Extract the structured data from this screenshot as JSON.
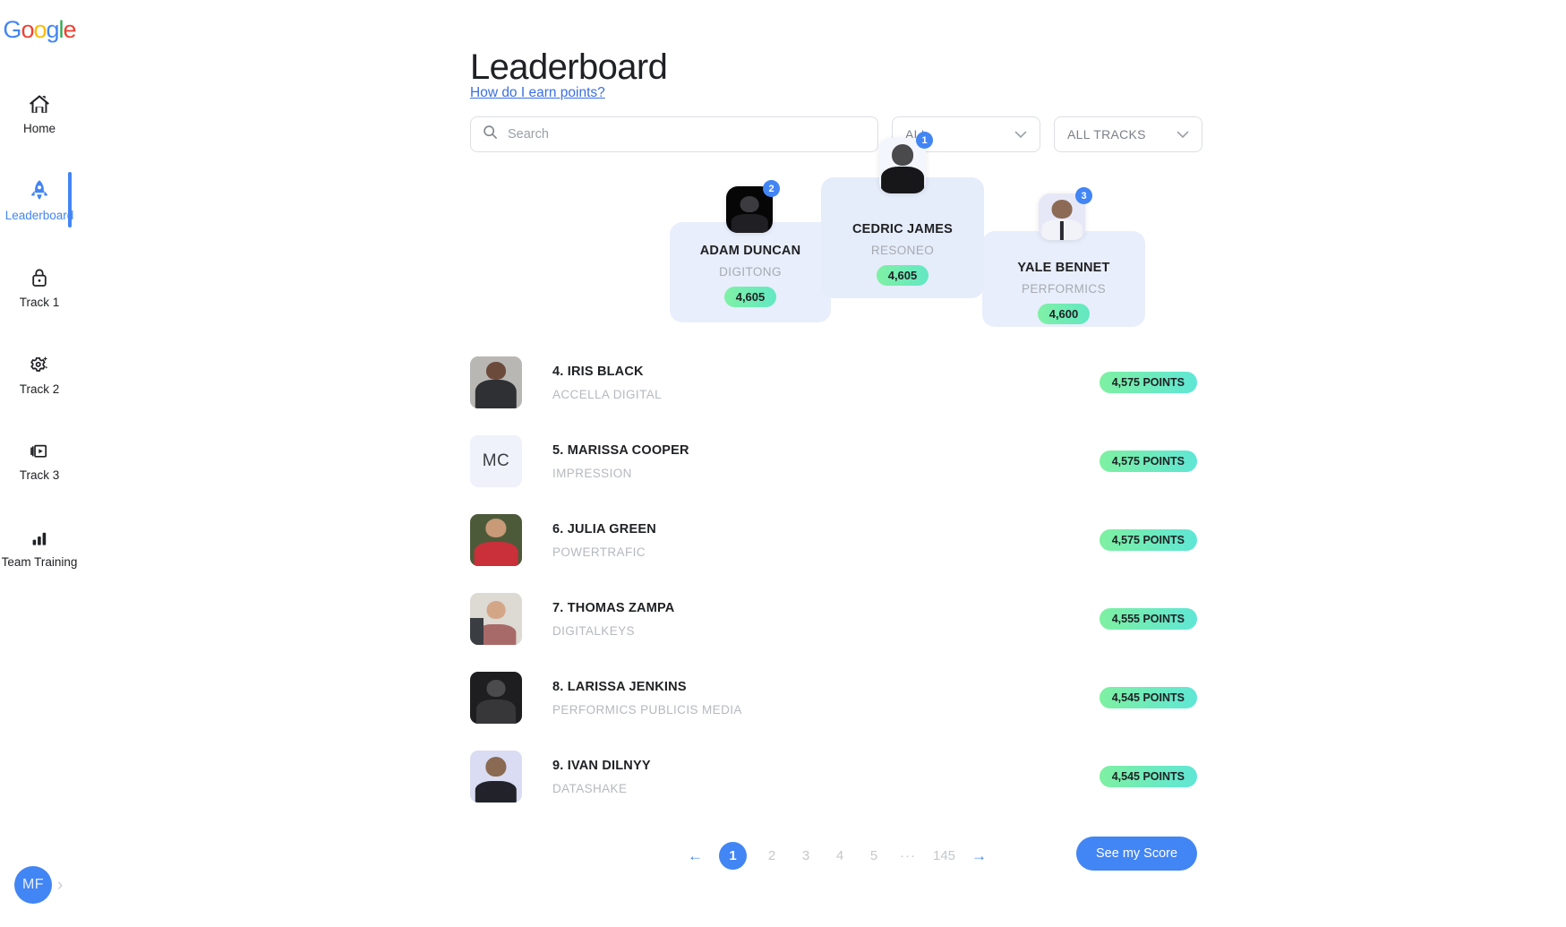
{
  "brand": {
    "logo_letters": [
      "G",
      "o",
      "o",
      "g",
      "l",
      "e"
    ]
  },
  "sidebar": {
    "items": [
      {
        "label": "Home",
        "icon": "home-icon",
        "active": false
      },
      {
        "label": "Leaderboard",
        "icon": "rocket-icon",
        "active": true
      },
      {
        "label": "Track 1",
        "icon": "lock-icon",
        "active": false
      },
      {
        "label": "Track 2",
        "icon": "gear-sparkle-icon",
        "active": false
      },
      {
        "label": "Track 3",
        "icon": "video-icon",
        "active": false
      },
      {
        "label": "Team Training",
        "icon": "bar-chart-icon",
        "active": false
      }
    ],
    "user": {
      "initials": "MF"
    }
  },
  "header": {
    "title": "Leaderboard",
    "help_link": "How do I earn points?"
  },
  "filters": {
    "search": {
      "placeholder": "Search",
      "value": ""
    },
    "scope_select": {
      "value": "ALL"
    },
    "track_select": {
      "value": "ALL TRACKS"
    }
  },
  "podium": [
    {
      "rank": "2",
      "name": "ADAM DUNCAN",
      "company": "DIGITONG",
      "score": "4,605",
      "avatar_style": "dark"
    },
    {
      "rank": "1",
      "name": "CEDRIC JAMES",
      "company": "RESONEO",
      "score": "4,605",
      "avatar_style": "light"
    },
    {
      "rank": "3",
      "name": "YALE BENNET",
      "company": "PERFORMICS",
      "score": "4,600",
      "avatar_style": "lavender"
    }
  ],
  "rows": [
    {
      "name": "4. IRIS BLACK",
      "company": "ACCELLA DIGITAL",
      "points": "4,575 POINTS",
      "initials": "",
      "avatar_style": "light"
    },
    {
      "name": "5. MARISSA COOPER",
      "company": "IMPRESSION",
      "points": "4,575 POINTS",
      "initials": "MC",
      "avatar_style": "initials"
    },
    {
      "name": "6. JULIA GREEN",
      "company": "POWERTRAFIC",
      "points": "4,575 POINTS",
      "initials": "",
      "avatar_style": "light"
    },
    {
      "name": "7. THOMAS ZAMPA",
      "company": "DIGITALKEYS",
      "points": "4,555 POINTS",
      "initials": "",
      "avatar_style": "light"
    },
    {
      "name": "8. LARISSA JENKINS",
      "company": "PERFORMICS PUBLICIS MEDIA",
      "points": "4,545 POINTS",
      "initials": "",
      "avatar_style": "dark"
    },
    {
      "name": "9. IVAN DILNYY",
      "company": "DATASHAKE",
      "points": "4,545 POINTS",
      "initials": "",
      "avatar_style": "lavender"
    }
  ],
  "pagination": {
    "prev": "←",
    "next": "→",
    "pages": [
      "1",
      "2",
      "3",
      "4",
      "5",
      "···",
      "145"
    ],
    "current": "1"
  },
  "actions": {
    "see_score": "See my Score"
  },
  "colors": {
    "accent_blue": "#4285F4",
    "podium_card": "#e8eefb",
    "score_badge_from": "#7ff0a5",
    "score_badge_to": "#63e8c3",
    "muted_text": "#a7abb0"
  }
}
